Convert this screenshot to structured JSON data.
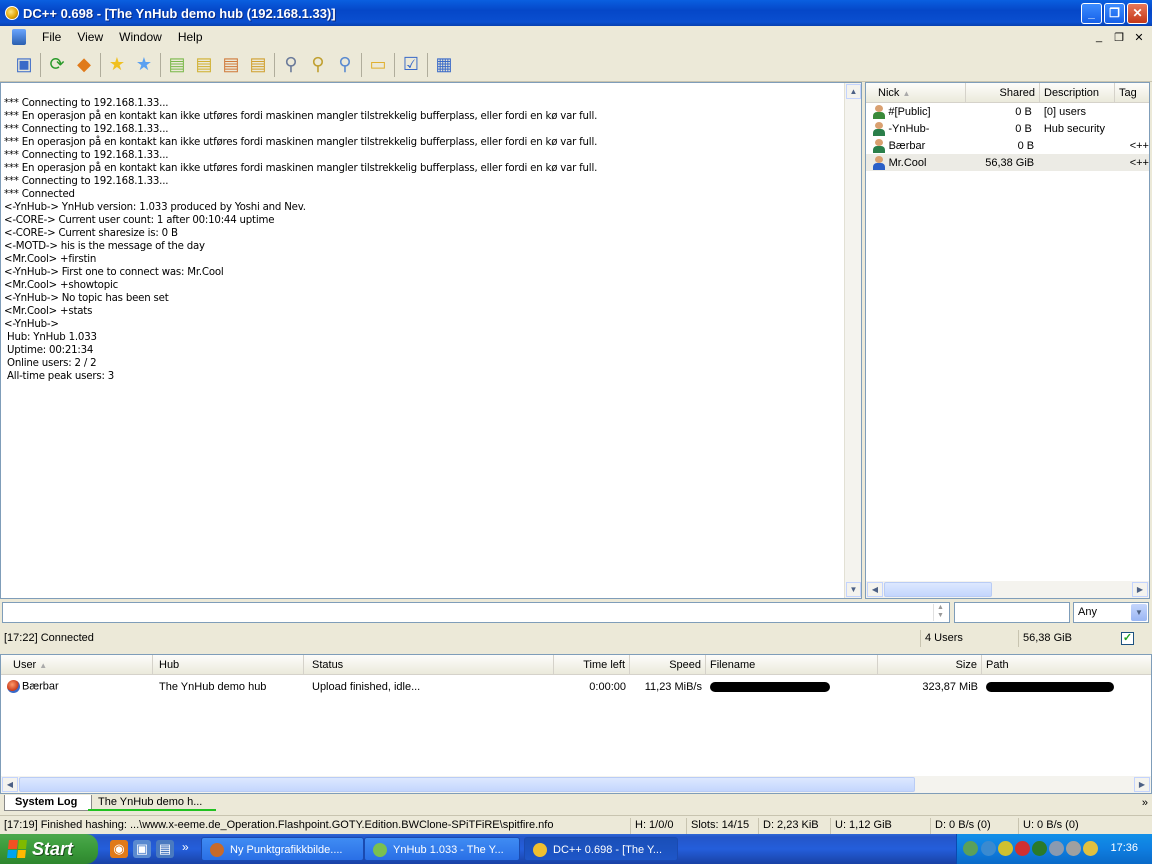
{
  "window": {
    "title": "DC++ 0.698 - [The YnHub demo hub (192.168.1.33)]"
  },
  "menu": {
    "items": [
      "File",
      "View",
      "Window",
      "Help"
    ]
  },
  "colors": {
    "titlebar": "#0a4fd0",
    "hub_tab_underline": "#21c121",
    "taskbar": "#245edb",
    "start_button": "#3a9a3a"
  },
  "toolbar": {
    "icons": [
      "connect-icon",
      "reconnect-icon",
      "follow-redirect-icon",
      "favorite-hubs-icon",
      "favorite-users-icon",
      "download-queue-icon",
      "finished-downloads-icon",
      "upload-queue-icon",
      "finished-uploads-icon",
      "search-icon",
      "adl-search-icon",
      "search-spy-icon",
      "open-file-list-icon",
      "settings-icon",
      "notepad-icon"
    ]
  },
  "chat": {
    "lines": [
      "*** Connecting to 192.168.1.33...",
      "*** En operasjon på en kontakt kan ikke utføres fordi maskinen mangler tilstrekkelig bufferplass, eller fordi en kø var full.",
      "*** Connecting to 192.168.1.33...",
      "*** En operasjon på en kontakt kan ikke utføres fordi maskinen mangler tilstrekkelig bufferplass, eller fordi en kø var full.",
      "*** Connecting to 192.168.1.33...",
      "*** En operasjon på en kontakt kan ikke utføres fordi maskinen mangler tilstrekkelig bufferplass, eller fordi en kø var full.",
      "*** Connecting to 192.168.1.33...",
      "*** Connected",
      "<-YnHub-> YnHub version: 1.033 produced by Yoshi and Nev.",
      "<-CORE-> Current user count: 1 after 00:10:44 uptime",
      "<-CORE-> Current sharesize is: 0 B",
      "<-MOTD-> his is the message of the day",
      "<Mr.Cool> +firstin",
      "<-YnHub-> First one to connect was: Mr.Cool",
      "<Mr.Cool> +showtopic",
      "<-YnHub-> No topic has been set",
      "<Mr.Cool> +stats",
      "<-YnHub->",
      " Hub: YnHub 1.033",
      " Uptime: 00:21:34",
      " Online users: 2 / 2",
      " All-time peak users: 3"
    ]
  },
  "userlist": {
    "columns": {
      "nick": "Nick",
      "shared": "Shared",
      "description": "Description",
      "tag": "Tag"
    },
    "rows": [
      {
        "nick": "#[Public]",
        "shared": "0 B",
        "description": "[0] users",
        "tag": ""
      },
      {
        "nick": "-YnHub-",
        "shared": "0 B",
        "description": "Hub security",
        "tag": ""
      },
      {
        "nick": "Bærbar",
        "shared": "0 B",
        "description": "",
        "tag": "<++"
      },
      {
        "nick": "Mr.Cool",
        "shared": "56,38 GiB",
        "description": "",
        "tag": "<++"
      }
    ]
  },
  "input": {
    "filter_mode": "Any"
  },
  "hub_status": {
    "message": "[17:22] Connected",
    "users": "4 Users",
    "shared": "56,38 GiB",
    "checkbox_mark": "✓"
  },
  "transfers": {
    "columns": {
      "user": "User",
      "hub": "Hub",
      "status": "Status",
      "time_left": "Time left",
      "speed": "Speed",
      "filename": "Filename",
      "size": "Size",
      "path": "Path"
    },
    "rows": [
      {
        "user": "Bærbar",
        "hub": "The YnHub demo hub",
        "status": "Upload finished, idle...",
        "time_left": "0:00:00",
        "speed": "11,23 MiB/s",
        "size": "323,87 MiB"
      }
    ]
  },
  "tabs": {
    "system_log": "System Log",
    "hub": "The YnHub demo h..."
  },
  "statusbar": {
    "message": "[17:19] Finished hashing: ...\\www.x-eeme.de_Operation.Flashpoint.GOTY.Edition.BWClone-SPiTFiRE\\spitfire.nfo",
    "hubs": "H: 1/0/0",
    "slots": "Slots: 14/15",
    "downloaded": "D: 2,23 KiB",
    "uploaded": "U: 1,12 GiB",
    "down_rate": "D: 0 B/s (0)",
    "up_rate": "U: 0 B/s (0)"
  },
  "taskbar": {
    "start_label": "Start",
    "more": "»",
    "tasks": [
      "Ny Punktgrafikkbilde....",
      "YnHub 1.033 - The Y...",
      "DC++ 0.698 - [The Y..."
    ],
    "clock": "17:36"
  }
}
